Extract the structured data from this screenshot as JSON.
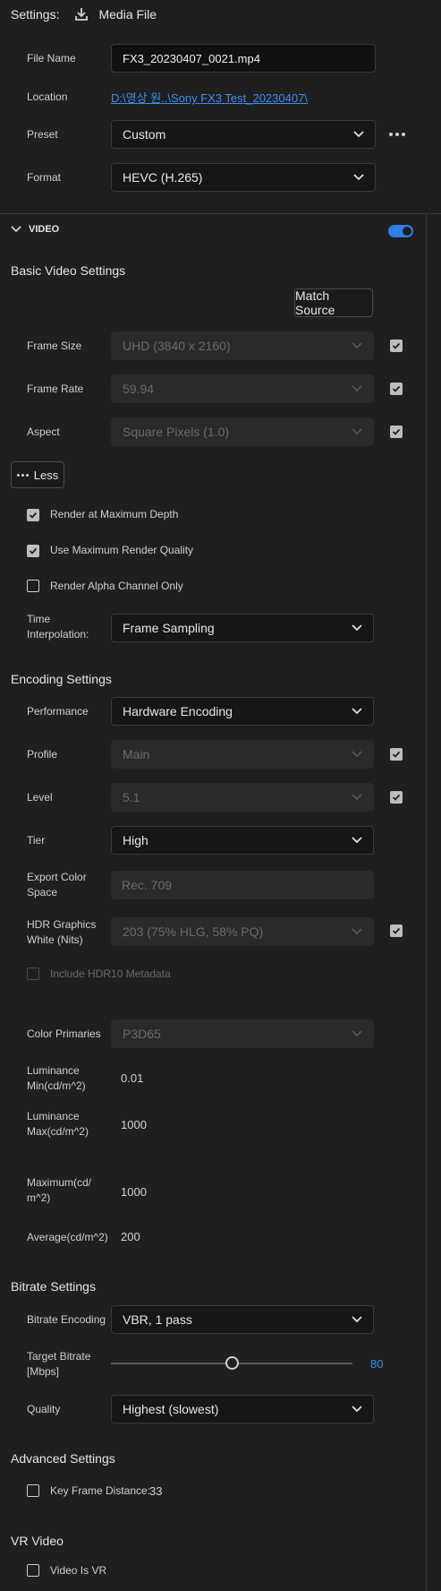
{
  "header": {
    "settings_label": "Settings:",
    "media_file_label": "Media File"
  },
  "file": {
    "file_name_label": "File Name",
    "file_name_value": "FX3_20230407_0021.mp4",
    "location_label": "Location",
    "location_value": "D:\\영상 원..\\Sony FX3 Test_20230407\\",
    "preset_label": "Preset",
    "preset_value": "Custom",
    "format_label": "Format",
    "format_value": "HEVC (H.265)"
  },
  "video": {
    "section_label": "VIDEO",
    "toggle_on": true,
    "basic": {
      "title": "Basic Video Settings",
      "match_source_label": "Match Source",
      "frame_size_label": "Frame Size",
      "frame_size_value": "UHD (3840 x 2160)",
      "frame_rate_label": "Frame Rate",
      "frame_rate_value": "59.94",
      "aspect_label": "Aspect",
      "aspect_value": "Square Pixels (1.0)",
      "less_label": "Less",
      "render_max_depth": "Render at Maximum Depth",
      "use_max_quality": "Use Maximum Render Quality",
      "render_alpha": "Render Alpha Channel Only",
      "time_interp_label_1": "Time",
      "time_interp_label_2": "Interpolation:",
      "time_interp_value": "Frame Sampling"
    },
    "encoding": {
      "title": "Encoding Settings",
      "performance_label": "Performance",
      "performance_value": "Hardware Encoding",
      "profile_label": "Profile",
      "profile_value": "Main",
      "level_label": "Level",
      "level_value": "5.1",
      "tier_label": "Tier",
      "tier_value": "High",
      "export_cs_label_1": "Export Color",
      "export_cs_label_2": "Space",
      "export_cs_value": "Rec. 709",
      "hdr_label_1": "HDR Graphics",
      "hdr_label_2": "White (Nits)",
      "hdr_value": "203 (75% HLG, 58% PQ)",
      "include_hdr10": "Include HDR10 Metadata",
      "color_primaries_label": "Color Primaries",
      "color_primaries_value": "P3D65",
      "lum_min_label_1": "Luminance",
      "lum_min_label_2": "Min(cd/m^2)",
      "lum_min_value": "0.01",
      "lum_max_label_1": "Luminance",
      "lum_max_label_2": "Max(cd/m^2)",
      "lum_max_value": "1000",
      "maximum_label_1": "Maximum(cd/",
      "maximum_label_2": "m^2)",
      "maximum_value": "1000",
      "average_label": "Average(cd/m^2)",
      "average_value": "200"
    },
    "bitrate": {
      "title": "Bitrate Settings",
      "encoding_label": "Bitrate Encoding",
      "encoding_value": "VBR, 1 pass",
      "target_label_1": "Target Bitrate",
      "target_label_2": "[Mbps]",
      "target_value": "80",
      "target_fraction": 0.5,
      "quality_label": "Quality",
      "quality_value": "Highest (slowest)"
    },
    "advanced": {
      "title": "Advanced Settings",
      "key_frame_label": "Key Frame Distance:",
      "key_frame_value": "33"
    },
    "vr": {
      "title": "VR Video",
      "video_is_vr": "Video Is VR"
    }
  },
  "colors": {
    "accent": "#3d8bf0",
    "link": "#3d8bf0"
  }
}
